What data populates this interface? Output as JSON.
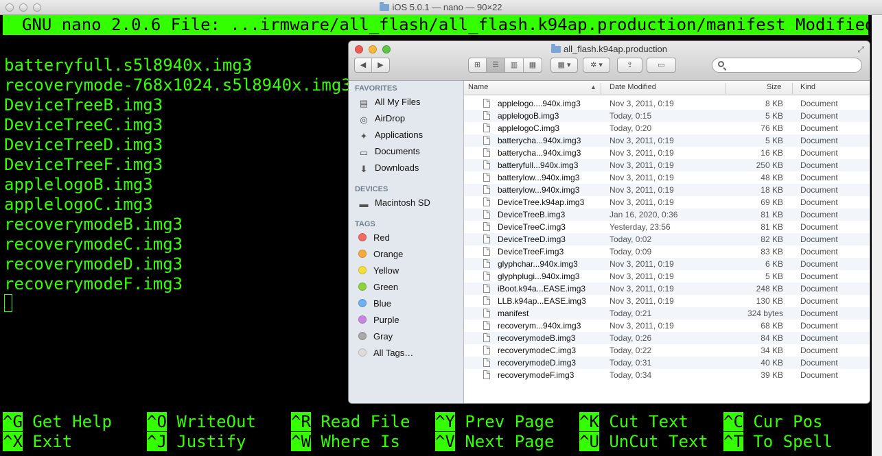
{
  "terminal": {
    "title": "iOS 5.0.1 — nano — 90×22",
    "header": "GNU nano 2.0.6 File: ...irmware/all_flash/all_flash.k94ap.production/manifest Modified",
    "lines": [
      "batteryfull.s5l8940x.img3",
      "recoverymode-768x1024.s5l8940x.img3",
      "DeviceTreeB.img3",
      "DeviceTreeC.img3",
      "DeviceTreeD.img3",
      "DeviceTreeF.img3",
      "applelogoB.img3",
      "applelogoC.img3",
      "recoverymodeB.img3",
      "recoverymodeC.img3",
      "recoverymodeD.img3",
      "recoverymodeF.img3"
    ],
    "shortcuts": [
      {
        "key": "^G",
        "label": "Get Help"
      },
      {
        "key": "^O",
        "label": "WriteOut"
      },
      {
        "key": "^R",
        "label": "Read File"
      },
      {
        "key": "^Y",
        "label": "Prev Page"
      },
      {
        "key": "^K",
        "label": "Cut Text"
      },
      {
        "key": "^C",
        "label": "Cur Pos"
      },
      {
        "key": "^X",
        "label": "Exit"
      },
      {
        "key": "^J",
        "label": "Justify"
      },
      {
        "key": "^W",
        "label": "Where Is"
      },
      {
        "key": "^V",
        "label": "Next Page"
      },
      {
        "key": "^U",
        "label": "UnCut Text"
      },
      {
        "key": "^T",
        "label": "To Spell"
      }
    ]
  },
  "finder": {
    "title": "all_flash.k94ap.production",
    "sidebar": {
      "favorites_heading": "FAVORITES",
      "favorites": [
        {
          "label": "All My Files",
          "icon": "all-files-icon",
          "glyph": "▤"
        },
        {
          "label": "AirDrop",
          "icon": "airdrop-icon",
          "glyph": "◎"
        },
        {
          "label": "Applications",
          "icon": "applications-icon",
          "glyph": "✦"
        },
        {
          "label": "Documents",
          "icon": "documents-icon",
          "glyph": "▭"
        },
        {
          "label": "Downloads",
          "icon": "downloads-icon",
          "glyph": "⬇"
        }
      ],
      "devices_heading": "DEVICES",
      "devices": [
        {
          "label": "Macintosh SD",
          "icon": "hard-drive-icon",
          "glyph": "▬"
        }
      ],
      "tags_heading": "TAGS",
      "tags": [
        {
          "label": "Red",
          "color": "#f36b64"
        },
        {
          "label": "Orange",
          "color": "#f7a93a"
        },
        {
          "label": "Yellow",
          "color": "#f4de3a"
        },
        {
          "label": "Green",
          "color": "#8ed23c"
        },
        {
          "label": "Blue",
          "color": "#6fb0f5"
        },
        {
          "label": "Purple",
          "color": "#c985e3"
        },
        {
          "label": "Gray",
          "color": "#a9a9a9"
        },
        {
          "label": "All Tags…",
          "color": "#dcdcdc"
        }
      ]
    },
    "columns": {
      "name": "Name",
      "date": "Date Modified",
      "size": "Size",
      "kind": "Kind"
    },
    "files": [
      {
        "name": "applelogo....940x.img3",
        "date": "Nov 3, 2011, 0:19",
        "size": "8 KB",
        "kind": "Document"
      },
      {
        "name": "applelogoB.img3",
        "date": "Today, 0:15",
        "size": "5 KB",
        "kind": "Document"
      },
      {
        "name": "applelogoC.img3",
        "date": "Today, 0:20",
        "size": "76 KB",
        "kind": "Document"
      },
      {
        "name": "batterycha...940x.img3",
        "date": "Nov 3, 2011, 0:19",
        "size": "5 KB",
        "kind": "Document"
      },
      {
        "name": "batterycha...940x.img3",
        "date": "Nov 3, 2011, 0:19",
        "size": "16 KB",
        "kind": "Document"
      },
      {
        "name": "batteryfull...940x.img3",
        "date": "Nov 3, 2011, 0:19",
        "size": "250 KB",
        "kind": "Document"
      },
      {
        "name": "batterylow...940x.img3",
        "date": "Nov 3, 2011, 0:19",
        "size": "48 KB",
        "kind": "Document"
      },
      {
        "name": "batterylow...940x.img3",
        "date": "Nov 3, 2011, 0:19",
        "size": "18 KB",
        "kind": "Document"
      },
      {
        "name": "DeviceTree.k94ap.img3",
        "date": "Nov 3, 2011, 0:19",
        "size": "69 KB",
        "kind": "Document"
      },
      {
        "name": "DeviceTreeB.img3",
        "date": "Jan 16, 2020, 0:36",
        "size": "81 KB",
        "kind": "Document"
      },
      {
        "name": "DeviceTreeC.img3",
        "date": "Yesterday, 23:56",
        "size": "81 KB",
        "kind": "Document"
      },
      {
        "name": "DeviceTreeD.img3",
        "date": "Today, 0:02",
        "size": "82 KB",
        "kind": "Document"
      },
      {
        "name": "DeviceTreeF.img3",
        "date": "Today, 0:09",
        "size": "83 KB",
        "kind": "Document"
      },
      {
        "name": "glyphchar...940x.img3",
        "date": "Nov 3, 2011, 0:19",
        "size": "6 KB",
        "kind": "Document"
      },
      {
        "name": "glyphplugi...940x.img3",
        "date": "Nov 3, 2011, 0:19",
        "size": "5 KB",
        "kind": "Document"
      },
      {
        "name": "iBoot.k94a...EASE.img3",
        "date": "Nov 3, 2011, 0:19",
        "size": "248 KB",
        "kind": "Document"
      },
      {
        "name": "LLB.k94ap...EASE.img3",
        "date": "Nov 3, 2011, 0:19",
        "size": "130 KB",
        "kind": "Document"
      },
      {
        "name": "manifest",
        "date": "Today, 0:21",
        "size": "324 bytes",
        "kind": "Document"
      },
      {
        "name": "recoverym...940x.img3",
        "date": "Nov 3, 2011, 0:19",
        "size": "68 KB",
        "kind": "Document"
      },
      {
        "name": "recoverymodeB.img3",
        "date": "Today, 0:26",
        "size": "84 KB",
        "kind": "Document"
      },
      {
        "name": "recoverymodeC.img3",
        "date": "Today, 0:22",
        "size": "34 KB",
        "kind": "Document"
      },
      {
        "name": "recoverymodeD.img3",
        "date": "Today, 0:31",
        "size": "40 KB",
        "kind": "Document"
      },
      {
        "name": "recoverymodeF.img3",
        "date": "Today, 0:34",
        "size": "39 KB",
        "kind": "Document"
      }
    ]
  }
}
